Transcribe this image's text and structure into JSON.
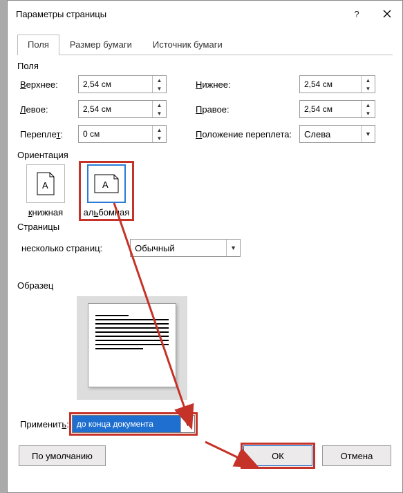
{
  "titlebar": {
    "title": "Параметры страницы"
  },
  "tabs": {
    "fields": "Поля",
    "paper_size": "Размер бумаги",
    "paper_source": "Источник бумаги"
  },
  "groups": {
    "margins": "Поля",
    "orientation": "Ориентация",
    "pages": "Страницы",
    "preview": "Образец"
  },
  "labels": {
    "top": "ерхнее:",
    "top_u": "В",
    "bottom": "ижнее:",
    "bottom_u": "Н",
    "left": "евое:",
    "left_u": "Л",
    "right": "равое:",
    "right_u": "П",
    "gutter": "Перепле",
    "gutter_u": "т",
    "gutter_rest": ":",
    "gutter_pos": "оложение переплета:",
    "gutter_pos_u": "П",
    "multi": "несколько страниц:",
    "apply": "Применит",
    "apply_u": "ь",
    "apply_rest": ":",
    "portrait": "нижная",
    "portrait_u": "к",
    "landscape": "ал",
    "landscape_u": "ь",
    "landscape_rest": "бомная"
  },
  "values": {
    "top": "2,54 см",
    "bottom": "2,54 см",
    "left": "2,54 см",
    "right": "2,54 см",
    "gutter": "0 см",
    "gutter_pos": "Слева",
    "multi": "Обычный",
    "apply": "до конца документа"
  },
  "buttons": {
    "defaults": "По умолчанию",
    "ok": "ОК",
    "cancel": "Отмена"
  }
}
